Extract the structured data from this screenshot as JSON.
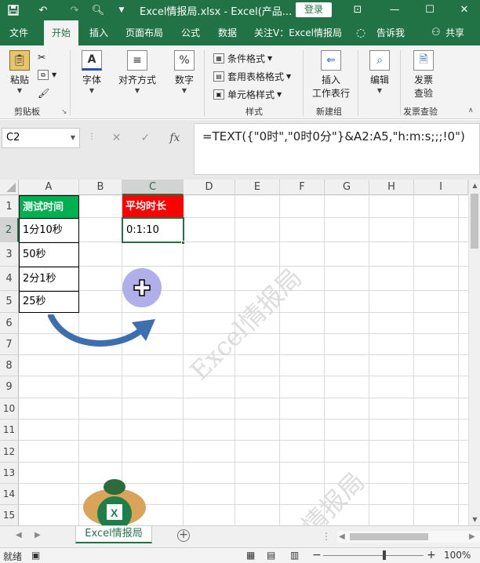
{
  "titlebar": {
    "title": "Excel情报局.xlsx  -  Excel(产品...",
    "login": "登录",
    "win_ribbon": "⊡",
    "win_min": "—",
    "win_max": "☐",
    "win_close": "✕"
  },
  "menu": {
    "items": [
      "文件",
      "开始",
      "插入",
      "页面布局",
      "公式",
      "数据",
      "关注V：Excel情报局"
    ],
    "active_index": 1,
    "tellme": "告诉我",
    "share": "共享"
  },
  "ribbon": {
    "paste": "粘贴",
    "clipboard": "剪贴板",
    "font": "字体",
    "align": "对齐方式",
    "number": "数字",
    "cond_format": "条件格式",
    "table_format": "套用表格格式",
    "cell_style": "单元格样式",
    "styles": "样式",
    "insert_row": "插入",
    "insert_row2": "工作表行",
    "new_group": "新建组",
    "edit": "编辑",
    "invoice1": "发票",
    "invoice2": "查验",
    "invoice_group": "发票查验"
  },
  "formula_bar": {
    "name_box": "C2",
    "formula": "=TEXT({\"0时\",\"0时0分\"}&A2:A5,\"h:m:s;;;!0\")"
  },
  "columns": [
    "A",
    "B",
    "C",
    "D",
    "E",
    "F",
    "G",
    "H",
    "I"
  ],
  "rows": [
    "1",
    "2",
    "3",
    "4",
    "5",
    "6",
    "7",
    "8",
    "9",
    "10",
    "11",
    "12",
    "13",
    "14",
    "15"
  ],
  "cells": {
    "a1": "测试时间",
    "a2": "1分10秒",
    "a3": "50秒",
    "a4": "2分1秒",
    "a5": "25秒",
    "c1": "平均时长",
    "c2": "0:1:10"
  },
  "watermark": "Excel情报局",
  "sheet_tab": "Excel情报局",
  "status": {
    "ready": "就绪",
    "zoom": "100%"
  }
}
